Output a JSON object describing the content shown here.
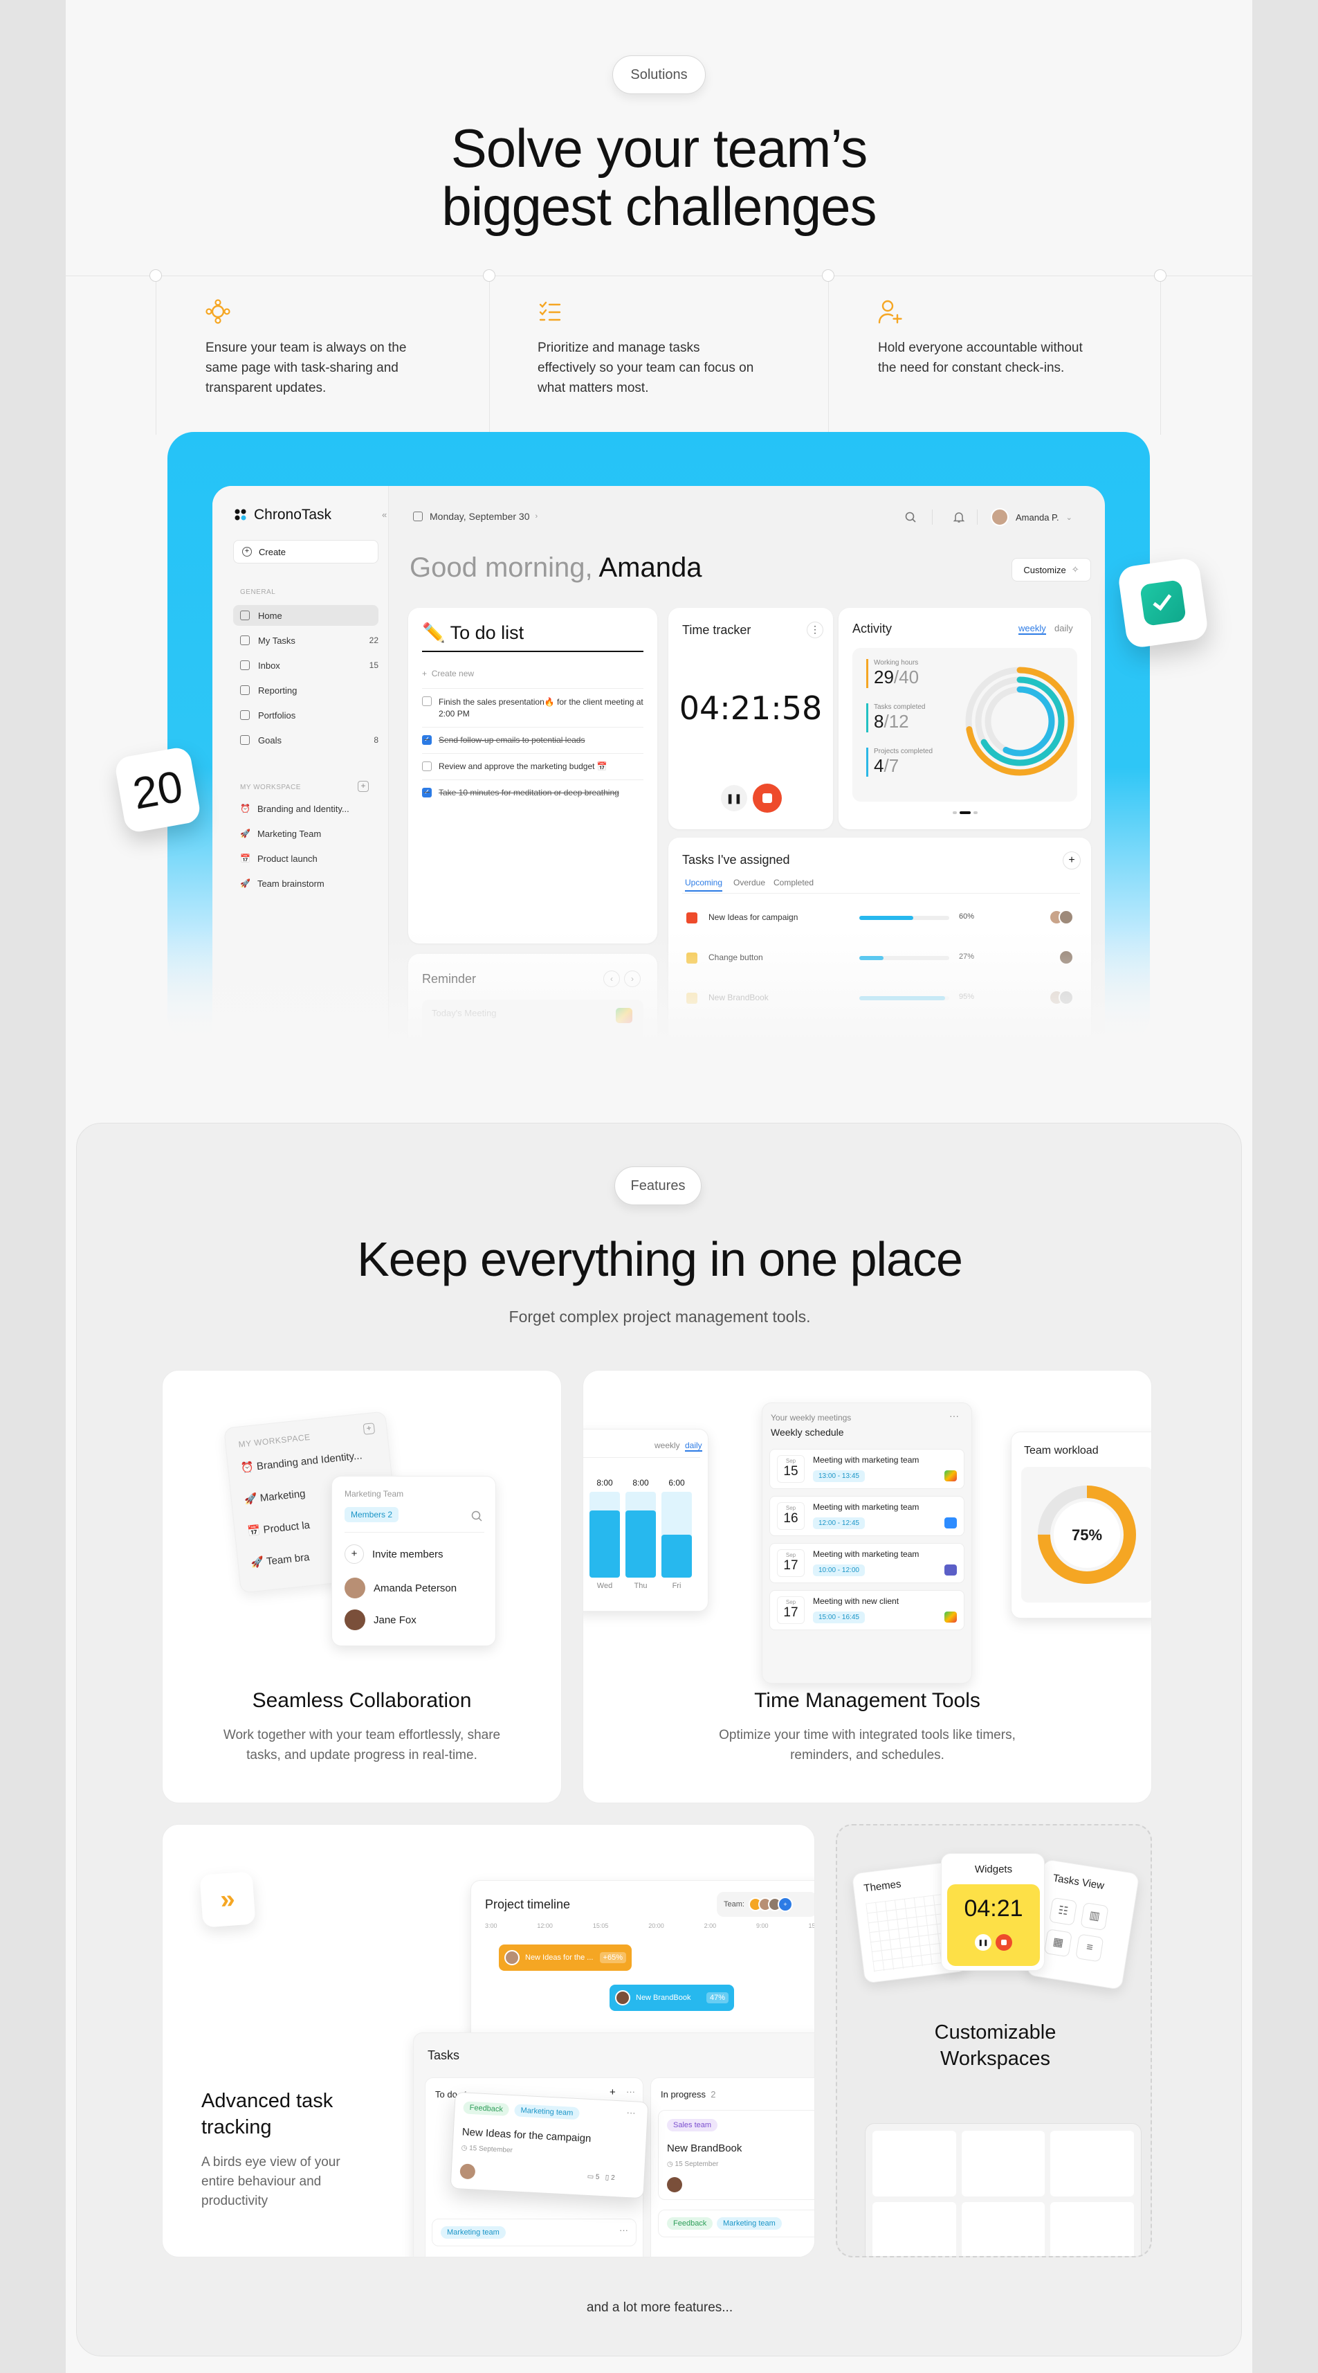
{
  "solutions": {
    "pill": "Solutions",
    "title_line1": "Solve your team’s",
    "title_line2": "biggest challenges",
    "columns": [
      {
        "icon": "nodes-icon",
        "text": "Ensure your team is always on the same page with task-sharing and transparent updates."
      },
      {
        "icon": "checklist-icon",
        "text": "Prioritize and manage tasks effectively so your team can focus on what matters most."
      },
      {
        "icon": "user-plus-icon",
        "text": "Hold everyone accountable without the need for constant check-ins."
      }
    ],
    "accent": "#f5a623"
  },
  "dashboard": {
    "brand": "ChronoTask",
    "date": "Monday, September 30",
    "user": "Amanda P.",
    "create": "Create",
    "general_label": "GENERAL",
    "nav": [
      {
        "label": "Home",
        "count": ""
      },
      {
        "label": "My Tasks",
        "count": "22"
      },
      {
        "label": "Inbox",
        "count": "15"
      },
      {
        "label": "Reporting",
        "count": ""
      },
      {
        "label": "Portfolios",
        "count": ""
      },
      {
        "label": "Goals",
        "count": "8"
      }
    ],
    "workspace_label": "MY WORKSPACE",
    "workspaces": [
      "Branding and Identity...",
      "Marketing Team",
      "Product launch",
      "Team brainstorm"
    ],
    "greeting": "Good morning,",
    "greeting_name": "Amanda",
    "customize": "Customize",
    "todo": {
      "title": "✏️ To do list",
      "create_new": "Create new",
      "items": [
        {
          "text": "Finish the sales presentation🔥 for the client meeting at 2:00 PM",
          "done": false
        },
        {
          "text": "Send follow-up emails to potential leads",
          "done": true
        },
        {
          "text": "Review and approve the marketing budget 📅",
          "done": false
        },
        {
          "text": "Take 10 minutes for meditation or deep breathing",
          "done": true
        }
      ]
    },
    "tracker": {
      "title": "Time tracker",
      "time": "04:21:58"
    },
    "activity": {
      "title": "Activity",
      "tab_weekly": "weekly",
      "tab_daily": "daily",
      "stats": [
        {
          "label": "Working hours",
          "value": "29",
          "total": "/40",
          "color": "#f5a623"
        },
        {
          "label": "Tasks completed",
          "value": "8",
          "total": "/12",
          "color": "#22c1c3"
        },
        {
          "label": "Projects completed",
          "value": "4",
          "total": "/7",
          "color": "#2bb8e6"
        }
      ]
    },
    "assigned": {
      "title": "Tasks I've assigned",
      "tabs": [
        "Upcoming",
        "Overdue",
        "Completed"
      ],
      "rows": [
        {
          "name": "New Ideas for campaign",
          "pct": "60%",
          "fill": 0.6,
          "color": "#ee4b2b"
        },
        {
          "name": "Change button",
          "pct": "27%",
          "fill": 0.27,
          "color": "#f5c542"
        },
        {
          "name": "New BrandBook",
          "pct": "95%",
          "fill": 0.95,
          "color": "#f5c542"
        }
      ]
    },
    "reminder": {
      "title": "Reminder",
      "item": "Today's Meeting"
    },
    "badge_number": "20"
  },
  "features": {
    "pill": "Features",
    "title": "Keep everything in one place",
    "subtitle": "Forget complex project management tools.",
    "collab": {
      "title": "Seamless Collaboration",
      "desc_line1": "Work together with your team effortlessly, share",
      "desc_line2": "tasks, and update progress in real-time.",
      "ws_label": "MY WORKSPACE",
      "ws_items": [
        "Branding and Identity...",
        "Marketing",
        "Product la",
        "Team bra"
      ],
      "team_label": "Marketing Team",
      "members_tag": "Members 2",
      "invite": "Invite members",
      "people": [
        "Amanda Peterson",
        "Jane Fox"
      ]
    },
    "time": {
      "title": "Time Management Tools",
      "desc_line1": "Optimize your time with integrated tools like timers,",
      "desc_line2": "reminders, and schedules.",
      "chart_tabs": [
        "weekly",
        "daily"
      ],
      "chart_bars": [
        {
          "day": "Wed",
          "time": "8:00",
          "fill": 0.78
        },
        {
          "day": "Thu",
          "time": "8:00",
          "fill": 0.78
        },
        {
          "day": "Fri",
          "time": "6:00",
          "fill": 0.5
        }
      ],
      "sched_head": "Your weekly meetings",
      "sched_title": "Weekly schedule",
      "meetings": [
        {
          "dow": "Sep",
          "day": "15",
          "title": "Meeting with marketing team",
          "time": "13:00 - 13:45",
          "color": "#2bb673"
        },
        {
          "dow": "Sep",
          "day": "16",
          "title": "Meeting with marketing team",
          "time": "12:00 - 12:45",
          "color": "#2d8cff"
        },
        {
          "dow": "Sep",
          "day": "17",
          "title": "Meeting with marketing team",
          "time": "10:00 - 12:00",
          "color": "#5b5fc7"
        },
        {
          "dow": "Sep",
          "day": "17",
          "title": "Meeting with new client",
          "time": "15:00 - 16:45",
          "color": "#2bb673"
        }
      ],
      "workload_title": "Team workload",
      "workload_value": "75%",
      "workload_fill": 0.75
    },
    "tracking": {
      "title_line1": "Advanced task",
      "title_line2": "tracking",
      "desc_line1": "A birds eye view of your",
      "desc_line2": "entire behaviour and",
      "desc_line3": "productivity",
      "timeline_title": "Project timeline",
      "team_label": "Team:",
      "ticks": [
        "3:00",
        "12:00",
        "15:05",
        "20:00",
        "2:00",
        "9:00",
        "15:00"
      ],
      "timeline_bars": [
        {
          "label": "New Ideas for the ...",
          "pct": "+65%",
          "color": "#f5a623"
        },
        {
          "label": "New BrandBook",
          "pct": "47%",
          "color": "#27b8ee"
        }
      ],
      "tasks_title": "Tasks",
      "todo_col": "To do",
      "todo_count": "4",
      "progress_col": "In progress",
      "progress_count": "2",
      "card1": {
        "tags": [
          "Feedback",
          "Marketing team"
        ],
        "title": "New Ideas for the campaign",
        "date": "15 September",
        "comments": "5",
        "files": "2"
      },
      "card2": {
        "tags": [
          "Sales team"
        ],
        "title": "New BrandBook",
        "date": "15 September"
      },
      "card3_tag": "Marketing team",
      "card4_tags": [
        "Feedback",
        "Marketing team"
      ]
    },
    "custom": {
      "title_line1": "Customizable",
      "title_line2": "Workspaces",
      "themes": "Themes",
      "widgets": "Widgets",
      "tasks_view": "Tasks View",
      "timer": "04:21"
    },
    "more": "and a lot more features..."
  }
}
